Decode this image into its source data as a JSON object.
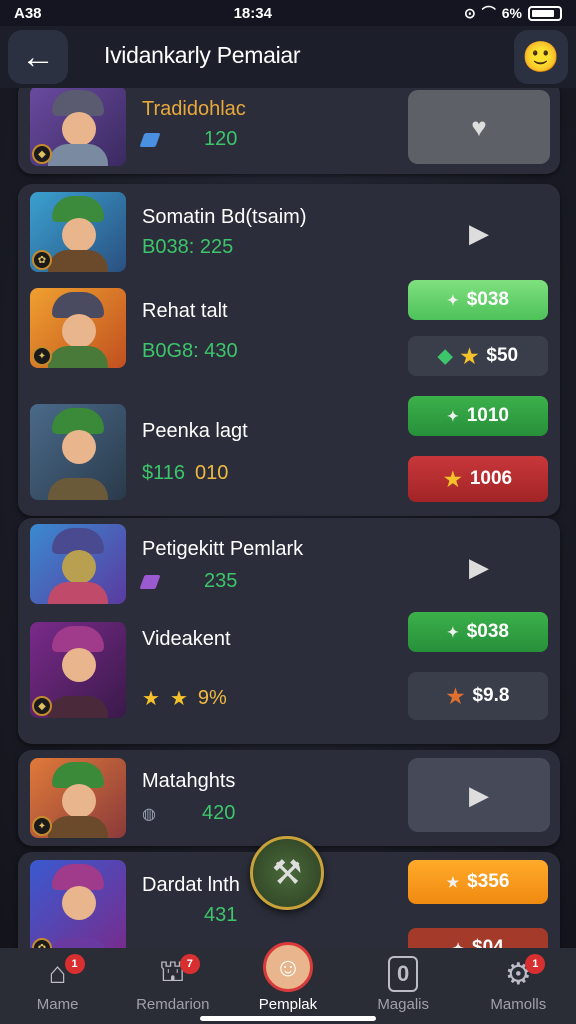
{
  "status": {
    "time": "A38",
    "center": "18:34",
    "battery": "6%"
  },
  "header": {
    "back_icon": "arrow-left-icon",
    "title": "Ividankarly Pemaiar",
    "profile_icon": "face-icon"
  },
  "items": [
    {
      "title": "Tradidohlac",
      "sub": "120",
      "button": "play",
      "icon": "heart-icon"
    },
    {
      "title": "Somatin Bd(tsaim)",
      "sub": "B038: 225"
    },
    {
      "title": "Rehat talt",
      "sub": "B0G8: 430",
      "price1": "$038",
      "price2": "$50"
    },
    {
      "title": "Peenka lagt",
      "sub_a": "$116",
      "sub_b": "010",
      "price1": "1010",
      "price2": "1006"
    },
    {
      "title": "Petigekitt Pemlark",
      "sub": "235"
    },
    {
      "title": "Videakent",
      "sub": "9%",
      "price1": "$038",
      "price2": "$9.8"
    },
    {
      "title": "Matahghts",
      "sub": "420"
    },
    {
      "title": "Dardat lnth",
      "sub": "431",
      "price1": "$356",
      "price2": "$04"
    }
  ],
  "nav": [
    {
      "label": "Mame",
      "badge": "1",
      "icon": "home-icon"
    },
    {
      "label": "Remdarion",
      "badge": "7",
      "icon": "store-icon"
    },
    {
      "label": "Pemplak",
      "icon": "avatar-icon"
    },
    {
      "label": "Magalis",
      "icon": "zero-icon",
      "glyph": "0"
    },
    {
      "label": "Mamolls",
      "badge": "1",
      "icon": "settings-icon"
    }
  ]
}
